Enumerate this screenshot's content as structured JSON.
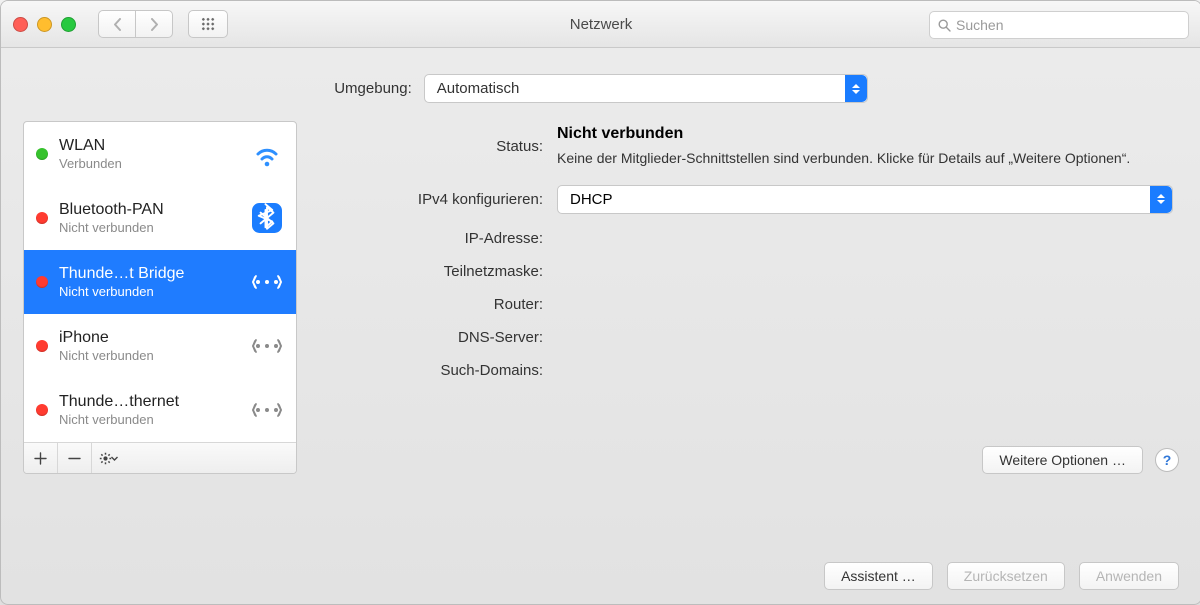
{
  "window": {
    "title": "Netzwerk"
  },
  "search": {
    "placeholder": "Suchen"
  },
  "location": {
    "label": "Umgebung:",
    "value": "Automatisch"
  },
  "sidebar": {
    "items": [
      {
        "name": "WLAN",
        "status_text": "Verbunden",
        "status": "green",
        "icon": "wifi"
      },
      {
        "name": "Bluetooth-PAN",
        "status_text": "Nicht verbunden",
        "status": "red",
        "icon": "bluetooth"
      },
      {
        "name": "Thunde…t Bridge",
        "status_text": "Nicht verbunden",
        "status": "red",
        "icon": "bridge",
        "selected": true
      },
      {
        "name": "iPhone",
        "status_text": "Nicht verbunden",
        "status": "red",
        "icon": "bridge"
      },
      {
        "name": "Thunde…thernet",
        "status_text": "Nicht verbunden",
        "status": "red",
        "icon": "bridge"
      }
    ]
  },
  "detail": {
    "labels": {
      "status": "Status:",
      "ipv4": "IPv4 konfigurieren:",
      "ip": "IP-Adresse:",
      "subnet": "Teilnetzmaske:",
      "router": "Router:",
      "dns": "DNS-Server:",
      "search_domains": "Such-Domains:"
    },
    "status_value": "Nicht verbunden",
    "status_desc": "Keine der Mitglieder-Schnittstellen sind verbunden. Klicke für Details auf „Weitere Optionen“.",
    "ipv4_value": "DHCP",
    "values": {
      "ip": "",
      "subnet": "",
      "router": "",
      "dns": "",
      "search_domains": ""
    },
    "advanced_button": "Weitere Optionen …"
  },
  "footer": {
    "assistant": "Assistent …",
    "revert": "Zurücksetzen",
    "apply": "Anwenden"
  }
}
